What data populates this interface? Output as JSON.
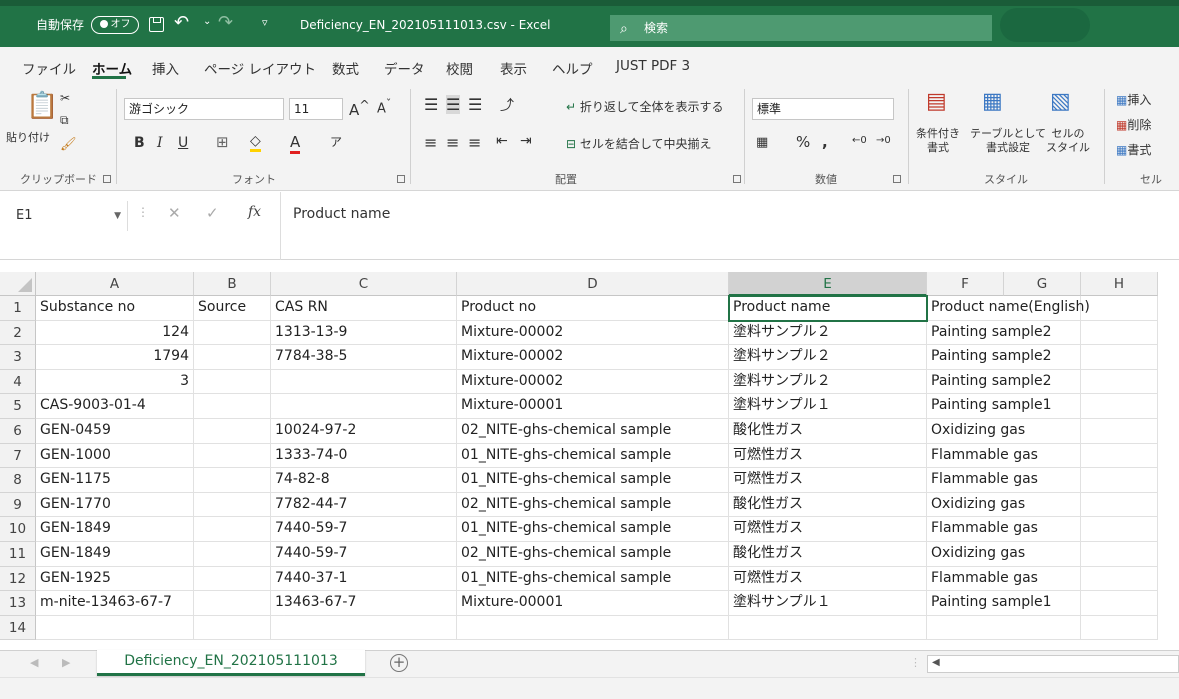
{
  "titlebar": {
    "autosave_label": "自動保存",
    "autosave_state": "オフ",
    "filename": "Deficiency_EN_202105111013.csv - Excel",
    "search_placeholder": "検索"
  },
  "ribbon_tabs": [
    "ファイル",
    "ホーム",
    "挿入",
    "ページ レイアウト",
    "数式",
    "データ",
    "校閲",
    "表示",
    "ヘルプ",
    "JUST PDF 3"
  ],
  "ribbon": {
    "clipboard": {
      "paste": "貼り付け",
      "label": "クリップボード"
    },
    "font": {
      "name": "游ゴシック",
      "size": "11",
      "label": "フォント"
    },
    "alignment": {
      "wrap": "折り返して全体を表示する",
      "merge": "セルを結合して中央揃え",
      "label": "配置"
    },
    "number": {
      "format": "標準",
      "label": "数値"
    },
    "styles": {
      "conditional": "条件付き\n書式",
      "table": "テーブルとして\n書式設定",
      "cell_styles": "セルの\nスタイル",
      "label": "スタイル"
    },
    "cells": {
      "insert": "挿入",
      "delete": "削除",
      "format": "書式",
      "label": "セル"
    }
  },
  "formula_bar": {
    "name_box": "E1",
    "formula": "Product name"
  },
  "columns": [
    "A",
    "B",
    "C",
    "D",
    "E",
    "F",
    "G",
    "H"
  ],
  "selected_column": "E",
  "rows": [
    {
      "n": "1",
      "A": "Substance no",
      "B": "Source",
      "C": "CAS RN",
      "D": "Product no",
      "E": "Product name",
      "F": "Product name(English)"
    },
    {
      "n": "2",
      "A": "124",
      "B": "",
      "C": "1313-13-9",
      "D": "Mixture-00002",
      "E": "塗料サンプル２",
      "F": "Painting sample2"
    },
    {
      "n": "3",
      "A": "1794",
      "B": "",
      "C": "7784-38-5",
      "D": "Mixture-00002",
      "E": "塗料サンプル２",
      "F": "Painting sample2"
    },
    {
      "n": "4",
      "A": "3",
      "B": "",
      "C": "",
      "D": "Mixture-00002",
      "E": "塗料サンプル２",
      "F": "Painting sample2"
    },
    {
      "n": "5",
      "A": "CAS-9003-01-4",
      "B": "",
      "C": "",
      "D": "Mixture-00001",
      "E": "塗料サンプル１",
      "F": "Painting sample1"
    },
    {
      "n": "6",
      "A": "GEN-0459",
      "B": "",
      "C": "10024-97-2",
      "D": "02_NITE-ghs-chemical sample",
      "E": "酸化性ガス",
      "F": "Oxidizing gas"
    },
    {
      "n": "7",
      "A": "GEN-1000",
      "B": "",
      "C": "1333-74-0",
      "D": "01_NITE-ghs-chemical sample",
      "E": "可燃性ガス",
      "F": "Flammable gas"
    },
    {
      "n": "8",
      "A": "GEN-1175",
      "B": "",
      "C": "74-82-8",
      "D": "01_NITE-ghs-chemical sample",
      "E": "可燃性ガス",
      "F": "Flammable gas"
    },
    {
      "n": "9",
      "A": "GEN-1770",
      "B": "",
      "C": "7782-44-7",
      "D": "02_NITE-ghs-chemical sample",
      "E": "酸化性ガス",
      "F": "Oxidizing gas"
    },
    {
      "n": "10",
      "A": "GEN-1849",
      "B": "",
      "C": "7440-59-7",
      "D": "01_NITE-ghs-chemical sample",
      "E": "可燃性ガス",
      "F": "Flammable gas"
    },
    {
      "n": "11",
      "A": "GEN-1849",
      "B": "",
      "C": "7440-59-7",
      "D": "02_NITE-ghs-chemical sample",
      "E": "酸化性ガス",
      "F": "Oxidizing gas"
    },
    {
      "n": "12",
      "A": "GEN-1925",
      "B": "",
      "C": "7440-37-1",
      "D": "01_NITE-ghs-chemical sample",
      "E": "可燃性ガス",
      "F": "Flammable gas"
    },
    {
      "n": "13",
      "A": "m-nite-13463-67-7",
      "B": "",
      "C": "13463-67-7",
      "D": "Mixture-00001",
      "E": "塗料サンプル１",
      "F": "Painting sample1"
    },
    {
      "n": "14",
      "A": "",
      "B": "",
      "C": "",
      "D": "",
      "E": "",
      "F": ""
    }
  ],
  "sheet_tab": "Deficiency_EN_202105111013",
  "colors": {
    "accent": "#217346",
    "title_bg": "#217346",
    "ribbon_bg": "#f3f3f3"
  }
}
